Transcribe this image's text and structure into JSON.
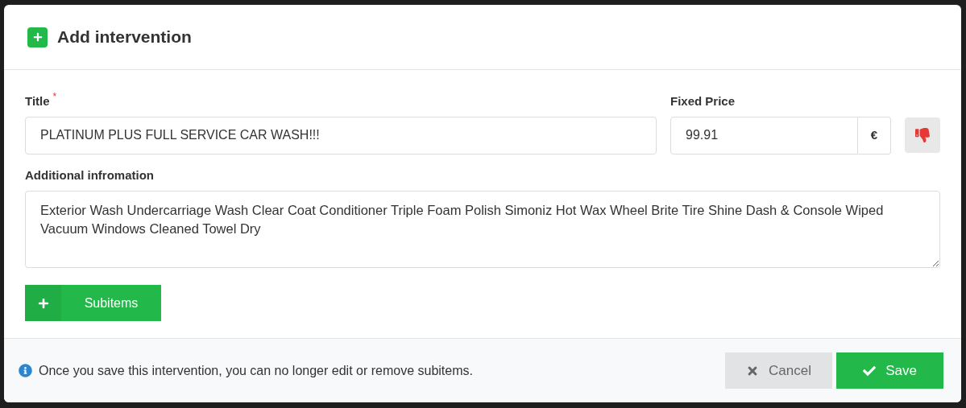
{
  "dialog": {
    "title": "Add intervention"
  },
  "fields": {
    "title": {
      "label": "Title",
      "required": true,
      "required_mark": "*",
      "value": "PLATINUM PLUS FULL SERVICE CAR WASH!!!"
    },
    "price": {
      "label": "Fixed Price",
      "value": "99.91",
      "unit": "€"
    },
    "info": {
      "label": "Additional infromation",
      "value": "Exterior Wash Undercarriage Wash Clear Coat Conditioner Triple Foam Polish Simoniz Hot Wax Wheel Brite Tire Shine Dash & Console Wiped Vacuum Windows Cleaned Towel Dry"
    }
  },
  "subitems_button": {
    "label": "Subitems"
  },
  "footer": {
    "note": "Once you save this intervention, you can no longer edit or remove subitems.",
    "buttons": [
      {
        "kind": "cancel",
        "label": "Cancel"
      },
      {
        "kind": "save",
        "label": "Save"
      }
    ]
  }
}
